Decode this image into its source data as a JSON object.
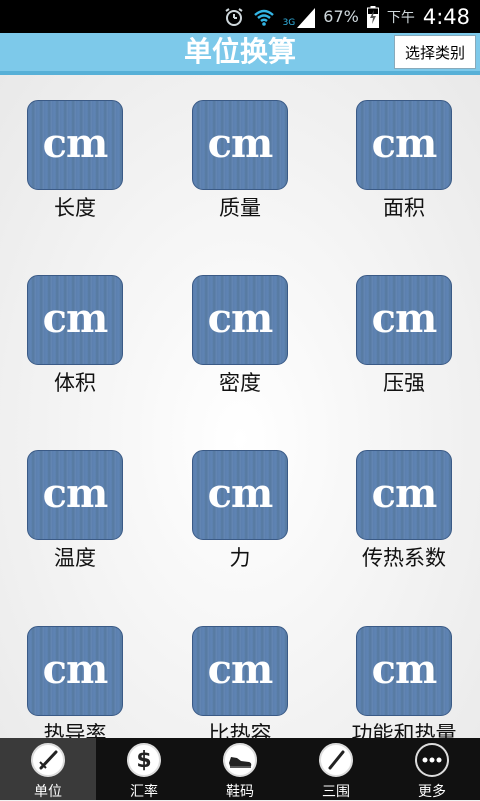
{
  "status_bar": {
    "battery_percent": "67%",
    "ampm": "下午",
    "time": "4:48",
    "network_label": "3G"
  },
  "header": {
    "title": "单位换算",
    "select_button": "选择类别"
  },
  "tiles": [
    {
      "icon_text": "cm",
      "label": "长度"
    },
    {
      "icon_text": "cm",
      "label": "质量"
    },
    {
      "icon_text": "cm",
      "label": "面积"
    },
    {
      "icon_text": "cm",
      "label": "体积"
    },
    {
      "icon_text": "cm",
      "label": "密度"
    },
    {
      "icon_text": "cm",
      "label": "压强"
    },
    {
      "icon_text": "cm",
      "label": "温度"
    },
    {
      "icon_text": "cm",
      "label": "力"
    },
    {
      "icon_text": "cm",
      "label": "传热系数"
    },
    {
      "icon_text": "cm",
      "label": "热导率"
    },
    {
      "icon_text": "cm",
      "label": "比热容"
    },
    {
      "icon_text": "cm",
      "label": "功能和热量"
    }
  ],
  "bottom_tabs": [
    {
      "label": "单位",
      "icon": "ruler-pen-icon",
      "active": true
    },
    {
      "label": "汇率",
      "icon": "dollar-icon",
      "active": false
    },
    {
      "label": "鞋码",
      "icon": "shoe-icon",
      "active": false
    },
    {
      "label": "三围",
      "icon": "pen-icon",
      "active": false
    },
    {
      "label": "更多",
      "icon": "more-icon",
      "active": false
    }
  ],
  "colors": {
    "title_bar": "#7dc9ea",
    "tile_blue": "#5b7fae",
    "bottom_bar": "#111111"
  }
}
